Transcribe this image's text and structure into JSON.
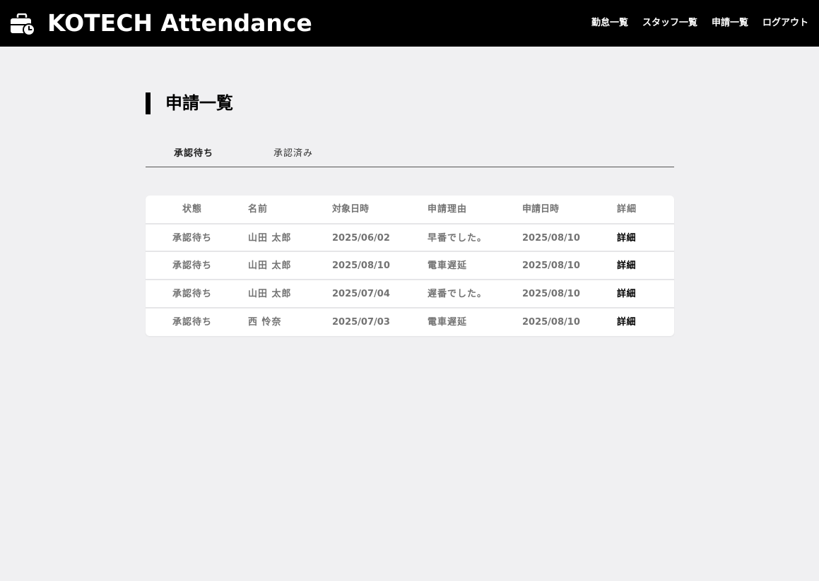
{
  "header": {
    "brand": "KOTECH Attendance",
    "logo_icon": "briefcase-clock-icon",
    "nav": [
      {
        "label": "勤怠一覧"
      },
      {
        "label": "スタッフ一覧"
      },
      {
        "label": "申請一覧"
      },
      {
        "label": "ログアウト"
      }
    ]
  },
  "page": {
    "title": "申請一覧"
  },
  "tabs": [
    {
      "label": "承認待ち",
      "active": true
    },
    {
      "label": "承認済み",
      "active": false
    }
  ],
  "table": {
    "columns": [
      "状態",
      "名前",
      "対象日時",
      "申請理由",
      "申請日時",
      "詳細"
    ],
    "rows": [
      {
        "status": "承認待ち",
        "name": "山田 太郎",
        "target_date": "2025/06/02",
        "reason": "早番でした。",
        "applied_date": "2025/08/10",
        "detail": "詳細"
      },
      {
        "status": "承認待ち",
        "name": "山田 太郎",
        "target_date": "2025/08/10",
        "reason": "電車遅延",
        "applied_date": "2025/08/10",
        "detail": "詳細"
      },
      {
        "status": "承認待ち",
        "name": "山田 太郎",
        "target_date": "2025/07/04",
        "reason": "遅番でした。",
        "applied_date": "2025/08/10",
        "detail": "詳細"
      },
      {
        "status": "承認待ち",
        "name": "西 怜奈",
        "target_date": "2025/07/03",
        "reason": "電車遅延",
        "applied_date": "2025/08/10",
        "detail": "詳細"
      }
    ]
  },
  "colors": {
    "header_bg": "#000000",
    "page_bg": "#f0f0f2",
    "text_muted": "#737373",
    "link": "#000000"
  }
}
